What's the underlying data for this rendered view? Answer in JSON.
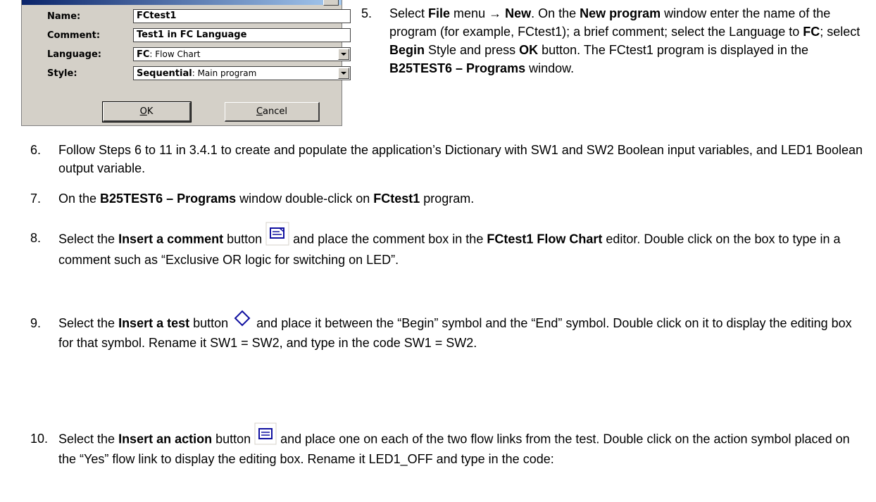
{
  "dialog": {
    "labels": {
      "name": "Name:",
      "comment": "Comment:",
      "language": "Language:",
      "style": "Style:"
    },
    "name_value": "FCtest1",
    "comment_value": "Test1 in FC Language",
    "language_value_bold": "FC",
    "language_value_rest": ": Flow Chart",
    "style_value_bold": "Sequential",
    "style_value_rest": ": Main program",
    "ok_label_ul": "O",
    "ok_label_rest": "K",
    "cancel_label_ul": "C",
    "cancel_label_rest": "ancel"
  },
  "steps": {
    "s5": {
      "number": "5.",
      "t1": "Select ",
      "b1": "File",
      "t2": " menu → ",
      "b2": "New",
      "t3": ". On the ",
      "b3": "New program",
      "t4": " window enter the name of the program (for example, FCtest1); a brief comment; select the Language to ",
      "b4": "FC",
      "t5": "; select ",
      "b5": "Begin",
      "t6": " Style and press ",
      "b6": "OK",
      "t7": " button. The FCtest1 program is displayed in the ",
      "b7": "B25TEST6 – Programs",
      "t8": " window."
    },
    "s6": {
      "number": "6.",
      "text": "Follow Steps 6 to 11 in 3.4.1 to create and populate the application’s Dictionary with SW1 and SW2 Boolean input variables, and LED1 Boolean output variable."
    },
    "s7": {
      "number": "7.",
      "t1": "On the ",
      "b1": "B25TEST6 – Programs",
      "t2": " window double-click on ",
      "b2": "FCtest1",
      "t3": " program."
    },
    "s8": {
      "number": "8.",
      "t1": "Select the ",
      "b1": "Insert a comment",
      "t2": " button ",
      "icon": "comment-icon",
      "t3": " and place the comment box in the ",
      "b2": "FCtest1 Flow Chart",
      "t4": " editor. Double click on the box to type in a comment such as “Exclusive OR logic for switching on LED”."
    },
    "s9": {
      "number": "9.",
      "t1": "Select the ",
      "b1": "Insert a test",
      "t2": " button ",
      "icon": "diamond-icon",
      "t3": " and place it between the “Begin” symbol and the “End” symbol. Double click on it to display the editing box for that symbol. Rename it SW1 = SW2, and type in the code SW1 = SW2."
    },
    "s10": {
      "number": "10.",
      "t1": "Select the ",
      "b1": "Insert an action",
      "t2": " button ",
      "icon": "action-icon",
      "t3": " and place one on each of the two flow links from the test. Double click on the action symbol placed on the “Yes” flow link to display the editing box. Rename it LED1_OFF and type in the code:"
    }
  }
}
